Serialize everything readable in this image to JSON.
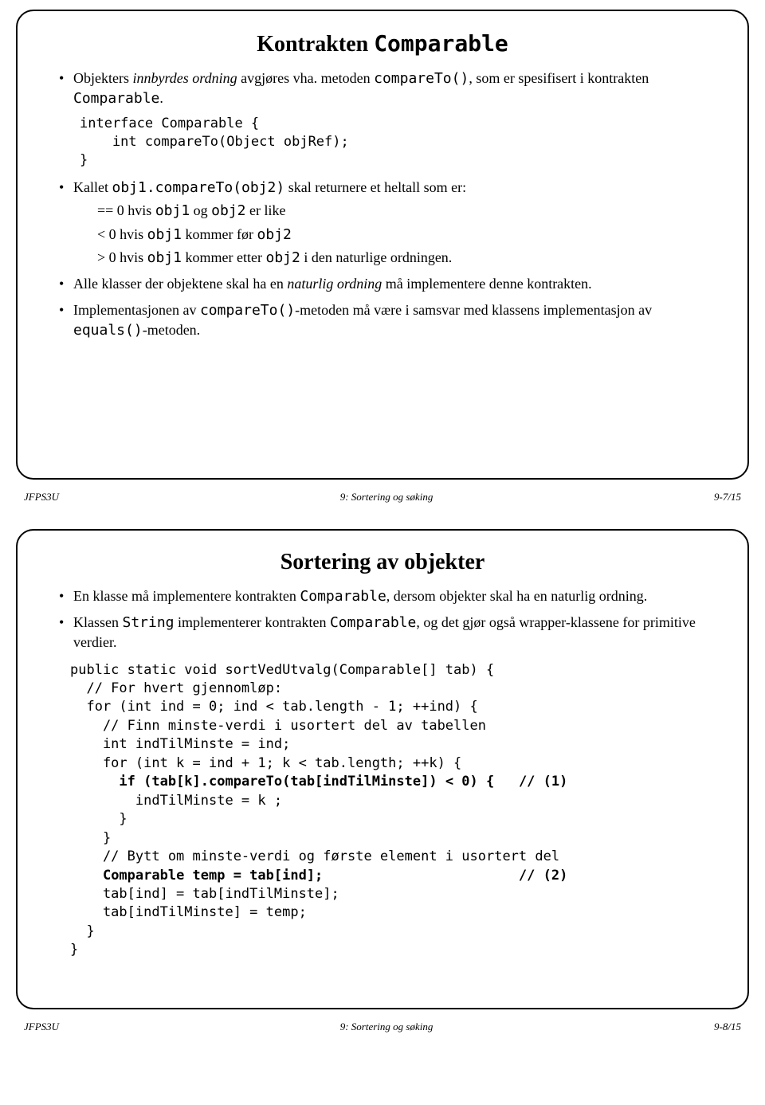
{
  "slide1": {
    "title_part1": "Kontrakten ",
    "title_code": "Comparable",
    "bullet1_a": "Objekters ",
    "bullet1_b": "innbyrdes ordning",
    "bullet1_c": " avgjøres vha. metoden ",
    "bullet1_d": "compareTo()",
    "bullet1_e": ", som er spesifisert i kontrakten ",
    "bullet1_f": "Comparable",
    "bullet1_g": ".",
    "code1": "interface Comparable {\n    int compareTo(Object objRef);\n}",
    "bullet2_a": "Kallet ",
    "bullet2_b": "obj1.compareTo(obj2)",
    "bullet2_c": " skal returnere et heltall som er:",
    "sub1_a": "== 0 hvis ",
    "sub1_b": "obj1",
    "sub1_c": " og ",
    "sub1_d": "obj2",
    "sub1_e": " er like",
    "sub2_a": "< 0 hvis ",
    "sub2_b": "obj1",
    "sub2_c": " kommer før ",
    "sub2_d": "obj2",
    "sub3_a": "> 0 hvis ",
    "sub3_b": "obj1",
    "sub3_c": " kommer etter ",
    "sub3_d": "obj2",
    "sub3_e": " i den naturlige ordningen.",
    "bullet3_a": "Alle klasser der objektene skal ha en ",
    "bullet3_b": "naturlig ordning",
    "bullet3_c": " må implementere denne kontrakten.",
    "bullet4_a": "Implementasjonen av ",
    "bullet4_b": "compareTo()",
    "bullet4_c": "-metoden må være i samsvar med klassens implementasjon av ",
    "bullet4_d": "equals()",
    "bullet4_e": "-metoden."
  },
  "footer1": {
    "left": "JFPS3U",
    "center": "9: Sortering og søking",
    "right": "9-7/15"
  },
  "slide2": {
    "title": "Sortering av objekter",
    "bullet1_a": "En klasse må implementere kontrakten ",
    "bullet1_b": "Comparable",
    "bullet1_c": ", dersom objekter skal ha en naturlig ordning.",
    "bullet2_a": "Klassen ",
    "bullet2_b": "String",
    "bullet2_c": " implementerer kontrakten ",
    "bullet2_d": "Comparable",
    "bullet2_e": ", og det gjør også wrapper-klassene for primitive verdier.",
    "code_l1": "public static void sortVedUtvalg(Comparable[] tab) {",
    "code_l2": "  // For hvert gjennomløp:",
    "code_l3": "  for (int ind = 0; ind < tab.length - 1; ++ind) {",
    "code_l4": "    // Finn minste-verdi i usortert del av tabellen",
    "code_l5": "    int indTilMinste = ind;",
    "code_l6": "    for (int k = ind + 1; k < tab.length; ++k) {",
    "code_l7a": "      ",
    "code_l7b": "if (tab[k].compareTo(tab[indTilMinste]) < 0) {",
    "code_l7c": "   // (1)",
    "code_l8": "        indTilMinste = k ;",
    "code_l9": "      }",
    "code_l10": "    }",
    "code_l11": "    // Bytt om minste-verdi og første element i usortert del",
    "code_l12a": "    ",
    "code_l12b": "Comparable temp = tab[ind];",
    "code_l12c": "                        // (2)",
    "code_l13": "    tab[ind] = tab[indTilMinste];",
    "code_l14": "    tab[indTilMinste] = temp;",
    "code_l15": "  }",
    "code_l16": "}"
  },
  "footer2": {
    "left": "JFPS3U",
    "center": "9: Sortering og søking",
    "right": "9-8/15"
  }
}
